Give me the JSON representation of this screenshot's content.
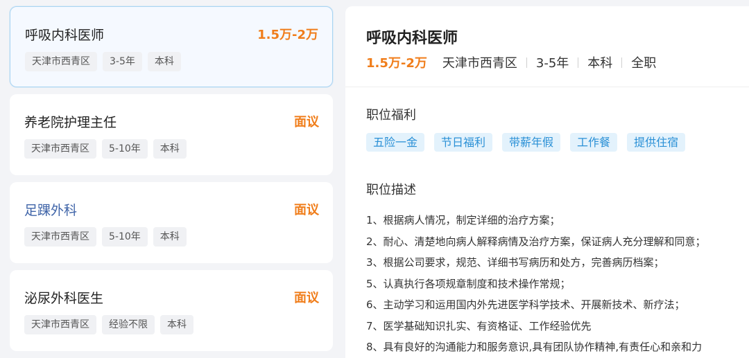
{
  "jobs": [
    {
      "title": "呼吸内科医师",
      "salary": "1.5万-2万",
      "tags": [
        "天津市西青区",
        "3-5年",
        "本科"
      ]
    },
    {
      "title": "养老院护理主任",
      "salary": "面议",
      "tags": [
        "天津市西青区",
        "5-10年",
        "本科"
      ]
    },
    {
      "title": "足踝外科",
      "salary": "面议",
      "tags": [
        "天津市西青区",
        "5-10年",
        "本科"
      ]
    },
    {
      "title": "泌尿外科医生",
      "salary": "面议",
      "tags": [
        "天津市西青区",
        "经验不限",
        "本科"
      ]
    }
  ],
  "detail": {
    "title": "呼吸内科医师",
    "salary": "1.5万-2万",
    "meta": [
      "天津市西青区",
      "3-5年",
      "本科",
      "全职"
    ],
    "benefits_heading": "职位福利",
    "benefits": [
      "五险一金",
      "节日福利",
      "带薪年假",
      "工作餐",
      "提供住宿"
    ],
    "description_heading": "职位描述",
    "description": [
      "1、根据病人情况，制定详细的治疗方案；",
      "2、耐心、清楚地向病人解释病情及治疗方案，保证病人充分理解和同意；",
      "3、根据公司要求，规范、详细书写病历和处方，完善病历档案；",
      "5、认真执行各项规章制度和技术操作常规；",
      "6、主动学习和运用国内外先进医学科学技术、开展新技术、新疗法；",
      "7、医学基础知识扎实、有资格证、工作经验优先",
      "8、具有良好的沟通能力和服务意识,具有团队协作精神,有责任心和亲和力"
    ]
  },
  "colors": {
    "salary": "#f07d1a",
    "active_border": "#a9d4f2",
    "benefit_text": "#2a90d6",
    "benefit_bg": "#e3f2fc",
    "link_title": "#3f64a8"
  }
}
